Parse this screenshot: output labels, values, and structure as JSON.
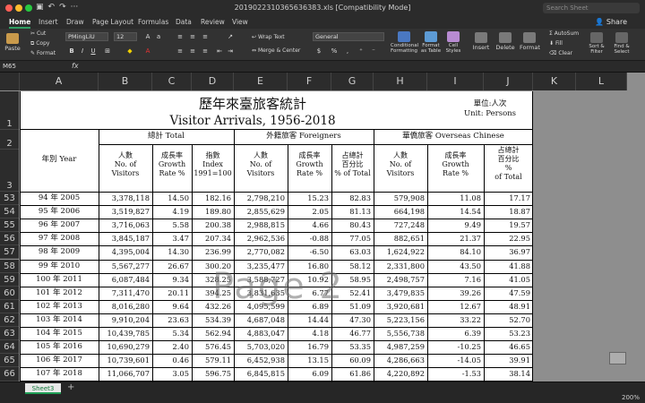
{
  "window": {
    "title": "2019022310365636383.xls  [Compatibility Mode]",
    "search_placeholder": "Search Sheet",
    "share": "Share"
  },
  "tabs": [
    "Home",
    "Insert",
    "Draw",
    "Page Layout",
    "Formulas",
    "Data",
    "Review",
    "View"
  ],
  "ribbon": {
    "paste": "Paste",
    "cut": "Cut",
    "copy": "Copy",
    "format": "Format",
    "font": "PMingLiU",
    "size": "12",
    "wrap": "Wrap Text",
    "merge": "Merge & Center",
    "numfmt": "General",
    "cond": "Conditional Formatting",
    "fat": "Format as Table",
    "cell_styles": "Cell Styles",
    "insert": "Insert",
    "delete": "Delete",
    "format2": "Format",
    "autosum": "AutoSum",
    "fill": "Fill",
    "clear": "Clear",
    "sort": "Sort & Filter",
    "find": "Find & Select",
    "pct": "%"
  },
  "formula": {
    "cell": "M65",
    "fx": "fx"
  },
  "columns": [
    "A",
    "B",
    "C",
    "D",
    "E",
    "F",
    "G",
    "H",
    "I",
    "J",
    "K",
    "L"
  ],
  "rows": [
    "1",
    "2",
    "3",
    "53",
    "54",
    "55",
    "56",
    "57",
    "58",
    "59",
    "60",
    "61",
    "62",
    "63",
    "64",
    "65",
    "66"
  ],
  "table": {
    "title_cn": "歷年來臺旅客統計",
    "title_en": "Visitor   Arrivals, 1956-2018",
    "unit_cn": "單位:人次",
    "unit_en": "Unit: Persons",
    "year_label": "年別 Year",
    "group_total": "總計 Total",
    "group_foreign": "外籍旅客 Foreigners",
    "group_overseas": "華僑旅客 Overseas Chinese",
    "h_visitors": [
      "人數",
      "No. of",
      "Visitors"
    ],
    "h_growth": [
      "成長率",
      "Growth",
      "Rate %"
    ],
    "h_index": [
      "指數",
      "Index",
      "1991=100"
    ],
    "h_share": [
      "占總計",
      "% of Total"
    ],
    "h_share_j": [
      "占總計",
      "百分比",
      "%",
      "of Total"
    ],
    "h_share_g": [
      "占總計",
      "百分比",
      "% of Total"
    ],
    "data": [
      [
        "94 年 2005",
        "3,378,118",
        "14.50",
        "182.16",
        "2,798,210",
        "15.23",
        "82.83",
        "579,908",
        "11.08",
        "17.17"
      ],
      [
        "95 年 2006",
        "3,519,827",
        "4.19",
        "189.80",
        "2,855,629",
        "2.05",
        "81.13",
        "664,198",
        "14.54",
        "18.87"
      ],
      [
        "96 年 2007",
        "3,716,063",
        "5.58",
        "200.38",
        "2,988,815",
        "4.66",
        "80.43",
        "727,248",
        "9.49",
        "19.57"
      ],
      [
        "97 年 2008",
        "3,845,187",
        "3.47",
        "207.34",
        "2,962,536",
        "-0.88",
        "77.05",
        "882,651",
        "21.37",
        "22.95"
      ],
      [
        "98 年 2009",
        "4,395,004",
        "14.30",
        "236.99",
        "2,770,082",
        "-6.50",
        "63.03",
        "1,624,922",
        "84.10",
        "36.97"
      ],
      [
        "99 年 2010",
        "5,567,277",
        "26.67",
        "300.20",
        "3,235,477",
        "16.80",
        "58.12",
        "2,331,800",
        "43.50",
        "41.88"
      ],
      [
        "100 年 2011",
        "6,087,484",
        "9.34",
        "328.25",
        "3,588,727",
        "10.92",
        "58.95",
        "2,498,757",
        "7.16",
        "41.05"
      ],
      [
        "101 年 2012",
        "7,311,470",
        "20.11",
        "394.25",
        "3,831,635",
        "6.77",
        "52.41",
        "3,479,835",
        "39.26",
        "47.59"
      ],
      [
        "102 年 2013",
        "8,016,280",
        "9.64",
        "432.26",
        "4,095,599",
        "6.89",
        "51.09",
        "3,920,681",
        "12.67",
        "48.91"
      ],
      [
        "103 年 2014",
        "9,910,204",
        "23.63",
        "534.39",
        "4,687,048",
        "14.44",
        "47.30",
        "5,223,156",
        "33.22",
        "52.70"
      ],
      [
        "104 年 2015",
        "10,439,785",
        "5.34",
        "562.94",
        "4,883,047",
        "4.18",
        "46.77",
        "5,556,738",
        "6.39",
        "53.23"
      ],
      [
        "105 年 2016",
        "10,690,279",
        "2.40",
        "576.45",
        "5,703,020",
        "16.79",
        "53.35",
        "4,987,259",
        "-10.25",
        "46.65"
      ],
      [
        "106 年 2017",
        "10,739,601",
        "0.46",
        "579.11",
        "6,452,938",
        "13.15",
        "60.09",
        "4,286,663",
        "-14.05",
        "39.91"
      ],
      [
        "107 年 2018",
        "11,066,707",
        "3.05",
        "596.75",
        "6,845,815",
        "6.09",
        "61.86",
        "4,220,892",
        "-1.53",
        "38.14"
      ]
    ]
  },
  "watermark": "Page 2",
  "sheet_tab": "Sheet3",
  "zoom": "200%"
}
